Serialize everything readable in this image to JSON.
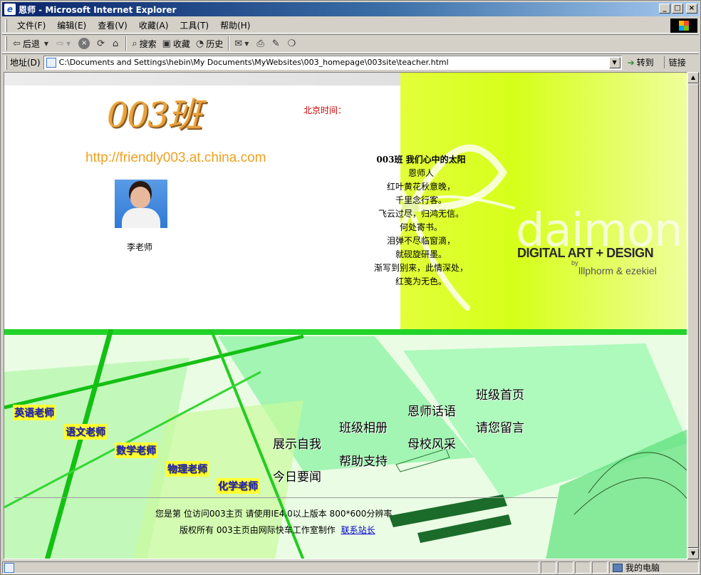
{
  "window": {
    "title": "恩师 - Microsoft Internet Explorer",
    "controls": {
      "minimize": "_",
      "maximize": "□",
      "close": "×"
    }
  },
  "menubar": {
    "items": [
      "文件(F)",
      "编辑(E)",
      "查看(V)",
      "收藏(A)",
      "工具(T)",
      "帮助(H)"
    ]
  },
  "toolbar": {
    "back": "后退",
    "search": "搜索",
    "favorites": "收藏",
    "history": "历史"
  },
  "addressbar": {
    "label": "地址(D)",
    "url": "C:\\Documents and Settings\\hebin\\My Documents\\MyWebsites\\003_homepage\\003site\\teacher.html",
    "go": "转到",
    "links": "链接"
  },
  "statusbar": {
    "zone": "我的电脑"
  },
  "page": {
    "class_logo": "003班",
    "site_url": "http://friendly003.at.china.com",
    "teacher_name": "李老师",
    "beijing_time_label": "北京时间：",
    "poem": {
      "title": "003班  我们心中的太阳",
      "lines": [
        "恩师人",
        "红叶黄花秋意晚，",
        "千里念行客。",
        "飞云过尽，归鸿无信。",
        "何处寄书。",
        "泪弹不尽临窗滴，",
        "就砚旋研墨。",
        "渐写到别来，此情深处，",
        "红笺为无色。"
      ]
    },
    "banner": {
      "logo_word": "daimonia",
      "tagline": "DIGITAL ART + DESIGN",
      "by": "by",
      "authors": "lllphorm & ezekiel"
    },
    "teacher_links": [
      "英语老师",
      "语文老师",
      "数学老师",
      "物理老师",
      "化学老师"
    ],
    "nav_links": {
      "home": "班级首页",
      "words": "恩师话语",
      "message": "请您留言",
      "album": "班级相册",
      "school": "母校风采",
      "showcase": "展示自我",
      "help": "帮助支持",
      "news": "今日要闻"
    },
    "footer": {
      "line1": "您是第  位访问003主页  请使用IE4.0以上版本  800*600分辨率",
      "line2": "版权所有  003主页由网际快车工作室制作",
      "contact": "联系站长"
    }
  }
}
